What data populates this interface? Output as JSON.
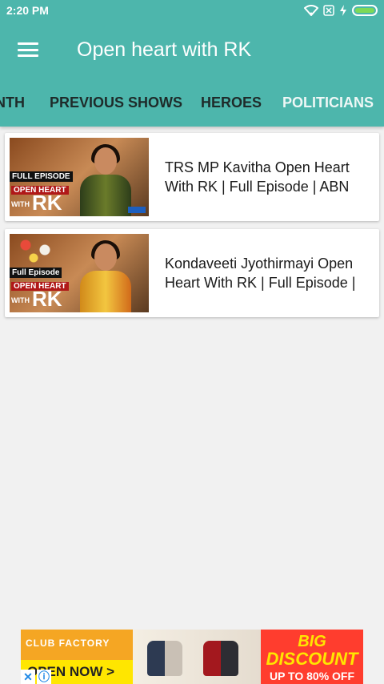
{
  "status": {
    "time": "2:20 PM"
  },
  "toolbar": {
    "title": "Open heart with RK"
  },
  "tabs": [
    {
      "label": "NTH"
    },
    {
      "label": "PREVIOUS SHOWS"
    },
    {
      "label": "HEROES"
    },
    {
      "label": "POLITICIANS"
    }
  ],
  "videos": [
    {
      "title": "TRS MP Kavitha Open Heart With RK | Full Episode | ABN",
      "thumb": {
        "badge": "FULL EPISODE",
        "open": "OPEN HEART",
        "with": "WITH",
        "rk": "RK"
      }
    },
    {
      "title": "Kondaveeti Jyothirmayi Open Heart With RK | Full Episode |",
      "thumb": {
        "badge": "Full Episode",
        "open": "OPEN HEART",
        "with": "WITH",
        "rk": "RK"
      }
    }
  ],
  "ad": {
    "brand": "CLUB FACTORY",
    "cta": "OPEN NOW >",
    "headline1": "BIG",
    "headline2": "DISCOUNT",
    "subline": "UP TO 80% OFF"
  },
  "colors": {
    "primary": "#4db6ac",
    "background": "#f1f1f1"
  }
}
